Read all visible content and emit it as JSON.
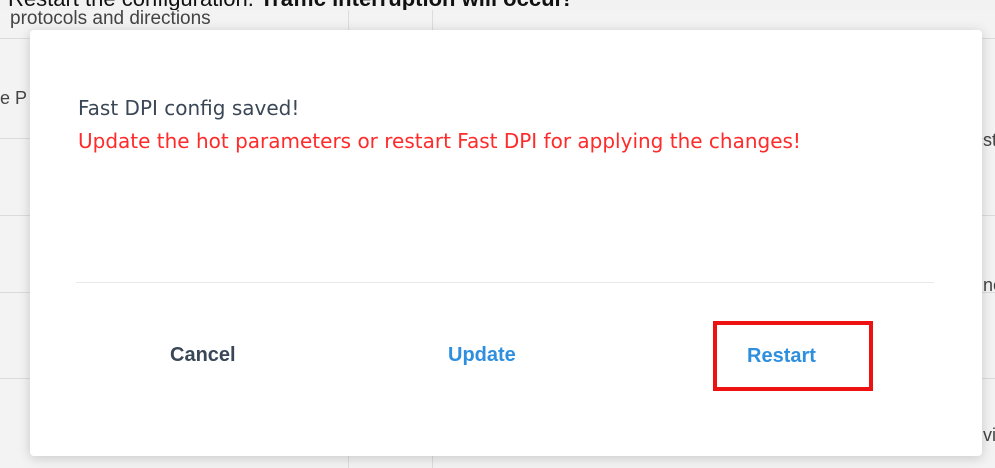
{
  "background": {
    "title_prefix": "Restart the configuration.",
    "title_bold": "Traffic interruption will occur!",
    "table_text": "protocols and directions",
    "fragments": [
      "e P",
      "st",
      "ne",
      "vi"
    ]
  },
  "dialog": {
    "message_saved": "Fast DPI config saved!",
    "message_warning": "Update the hot parameters or restart Fast DPI for applying the changes!",
    "buttons": {
      "cancel": "Cancel",
      "update": "Update",
      "restart": "Restart"
    }
  },
  "colors": {
    "warning_text": "#ff2a2a",
    "primary_button": "#2f8fdf",
    "secondary_button": "#3a4756",
    "highlight_border": "#ee1111"
  }
}
